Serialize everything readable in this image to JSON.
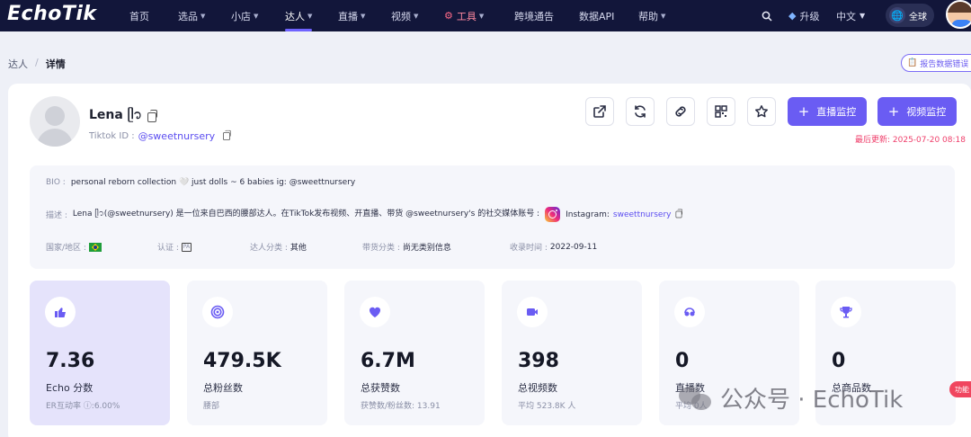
{
  "app": {
    "logo": "EchoTik"
  },
  "nav": {
    "items": [
      {
        "label": "首页",
        "chevron": false
      },
      {
        "label": "选品",
        "chevron": true
      },
      {
        "label": "小店",
        "chevron": true
      },
      {
        "label": "达人",
        "chevron": true,
        "active": true
      },
      {
        "label": "直播",
        "chevron": true
      },
      {
        "label": "视频",
        "chevron": true
      },
      {
        "label": "工具",
        "chevron": true
      },
      {
        "label": "跨境通告",
        "chevron": false
      },
      {
        "label": "数据API",
        "chevron": false
      },
      {
        "label": "帮助",
        "chevron": true
      }
    ],
    "upgrade": "升级",
    "language": "中文",
    "region": "全球"
  },
  "breadcrumb": {
    "parent": "达人",
    "separator": "/",
    "current": "详情"
  },
  "report_button": "报告数据错误",
  "profile": {
    "name": "Lena ᥫ᭡",
    "tiktok_id_label": "Tiktok ID :",
    "handle": "@sweetnursery",
    "last_updated": "最后更新: 2025-07-20 08:18"
  },
  "actions": {
    "live_monitor": "直播监控",
    "video_monitor": "视频监控"
  },
  "info": {
    "bio_label": "BIO :",
    "bio": "personal reborn collection 🤍 just dolls ~ 6 babies ig: @sweettnursery",
    "desc_label": "描述 :",
    "desc": "Lena ᥫ᭡(@sweetnursery) 是一位来自巴西的腰部达人。在TikTok发布视频、开直播、带货 @sweetnursery's 的社交媒体账号 :",
    "instagram_label": "Instagram:",
    "instagram_handle": "sweettnursery",
    "country_label": "国家/地区 :",
    "cert_label": "认证 :",
    "category_label": "达人分类 :",
    "category": "其他",
    "goods_label": "带货分类 :",
    "goods": "尚无类别信息",
    "collected_label": "收录时间 :",
    "collected": "2022-09-11"
  },
  "stats": [
    {
      "icon": "thumbs-up-icon",
      "value": "7.36",
      "label": "Echo 分数",
      "sub": "ER互动率 ⓘ:6.00%",
      "highlight": true
    },
    {
      "icon": "target-icon",
      "value": "479.5K",
      "label": "总粉丝数",
      "sub": "腰部"
    },
    {
      "icon": "heart-icon",
      "value": "6.7M",
      "label": "总获赞数",
      "sub": "获赞数/粉丝数: 13.91"
    },
    {
      "icon": "video-icon",
      "value": "398",
      "label": "总视频数",
      "sub": "平均 523.8K 人"
    },
    {
      "icon": "live-icon",
      "value": "0",
      "label": "直播数",
      "sub": "平均 0人"
    },
    {
      "icon": "trophy-icon",
      "value": "0",
      "label": "总商品数",
      "sub": ""
    }
  ],
  "watermark": "公众号 · EchoTik",
  "side_tag": "功能"
}
